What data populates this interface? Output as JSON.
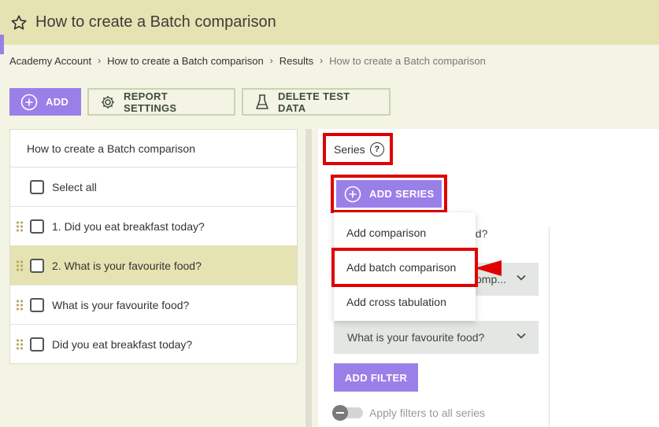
{
  "header": {
    "title": "How to create a Batch comparison"
  },
  "breadcrumb": {
    "items": [
      "Academy Account",
      "How to create a Batch comparison",
      "Results"
    ],
    "current": "How to create a Batch comparison"
  },
  "toolbar": {
    "add_label": "ADD",
    "report_settings_label": "REPORT SETTINGS",
    "delete_test_data_label": "DELETE TEST DATA"
  },
  "left_panel": {
    "header": "How to create a Batch comparison",
    "select_all_label": "Select all",
    "questions": [
      {
        "label": "1.  Did you eat breakfast today?",
        "selected": false
      },
      {
        "label": "2.  What is your favourite food?",
        "selected": true
      },
      {
        "label": "What is your favourite food?",
        "selected": false
      },
      {
        "label": "Did you eat breakfast today?",
        "selected": false
      }
    ]
  },
  "series": {
    "label": "Series",
    "help": "?",
    "add_series_label": "ADD SERIES",
    "behind_question_text": "od?",
    "dropdown1_text": "omp...",
    "dropdown2_text": "What is your favourite food?",
    "add_filter_label": "ADD FILTER",
    "apply_filters_label": "Apply filters to all series"
  },
  "menu": {
    "items": [
      "Add comparison",
      "Add batch comparison",
      "Add cross tabulation"
    ]
  },
  "colors": {
    "accent": "#9b7fe8",
    "highlight": "#e00000",
    "header_bg": "#e6e3b2"
  }
}
